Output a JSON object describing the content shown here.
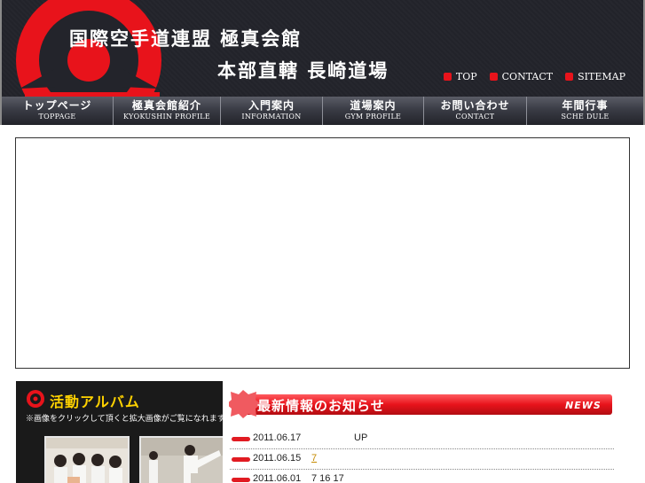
{
  "header": {
    "title_line1": "国際空手道連盟 極真会館",
    "title_line2": "本部直轄 長崎道場",
    "toplinks": [
      {
        "label": "TOP"
      },
      {
        "label": "CONTACT"
      },
      {
        "label": "SITEMAP"
      }
    ],
    "logo_icon": "kyokushin-kanku-emblem",
    "colors": {
      "accent": "#e8131b",
      "header_bg": "#23242b"
    }
  },
  "nav": {
    "items": [
      {
        "jp": "トップページ",
        "en": "TOPPAGE"
      },
      {
        "jp": "極真会館紹介",
        "en": "KYOKUSHIN PROFILE"
      },
      {
        "jp": "入門案内",
        "en": "INFORMATION"
      },
      {
        "jp": "道場案内",
        "en": "GYM PROFILE"
      },
      {
        "jp": "お問い合わせ",
        "en": "CONTACT"
      },
      {
        "jp": "年間行事",
        "en": "SCHE DULE"
      }
    ]
  },
  "album": {
    "title": "活動アルバム",
    "note": "※画像をクリックして頂くと拡大画像がご覧になれます。"
  },
  "news": {
    "title": "最新情報のお知らせ",
    "tag": "NEWS",
    "items": [
      {
        "date": "2011.06.17",
        "text": "UP"
      },
      {
        "date": "2011.06.15",
        "text": "7"
      },
      {
        "date": "2011.06.01",
        "text": "7 16 17"
      }
    ]
  }
}
